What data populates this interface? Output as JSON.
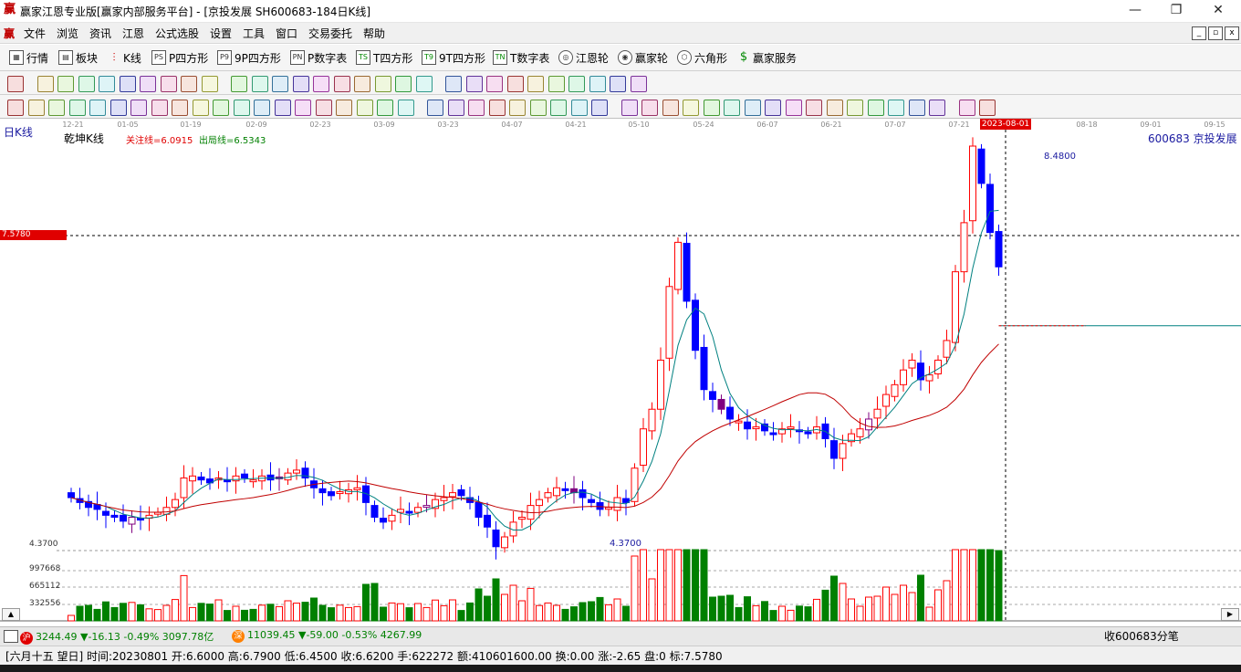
{
  "window": {
    "title": "赢家江恩专业版[赢家内部服务平台] - [京投发展  SH600683-184日K线]",
    "logo_char": "赢",
    "controls": {
      "minimize": "—",
      "restore": "❐",
      "close": "✕"
    }
  },
  "menubar": {
    "items": [
      "文件",
      "浏览",
      "资讯",
      "江恩",
      "公式选股",
      "设置",
      "工具",
      "窗口",
      "交易委托",
      "帮助"
    ],
    "mdi_controls": [
      "_",
      "▫",
      "x"
    ]
  },
  "toolbar1": {
    "buttons": [
      {
        "label": "行情",
        "icon": "grid-icon"
      },
      {
        "label": "板块",
        "icon": "blocks-icon"
      },
      {
        "label": "K线",
        "icon": "candle-icon"
      },
      {
        "label": "P四方形",
        "icon": "ps-icon",
        "icon_text": "PS"
      },
      {
        "label": "9P四方形",
        "icon": "p9-icon",
        "icon_text": "P9"
      },
      {
        "label": "P数字表",
        "icon": "pn-icon",
        "icon_text": "PN"
      },
      {
        "label": "T四方形",
        "icon": "ts-icon",
        "icon_text": "TS"
      },
      {
        "label": "9T四方形",
        "icon": "t9-icon",
        "icon_text": "T9"
      },
      {
        "label": "T数字表",
        "icon": "tn-icon",
        "icon_text": "TN"
      },
      {
        "label": "江恩轮",
        "icon": "wheel-icon"
      },
      {
        "label": "赢家轮",
        "icon": "wheel2-icon"
      },
      {
        "label": "六角形",
        "icon": "hexagon-icon"
      },
      {
        "label": "赢家服务",
        "icon": "dollar-icon"
      }
    ]
  },
  "chart": {
    "date_labels": [
      "12-21",
      "01-05",
      "01-19",
      "02-09",
      "02-23",
      "03-09",
      "03-23",
      "04-07",
      "04-21",
      "05-10",
      "05-24",
      "06-07",
      "06-21",
      "07-07",
      "07-21",
      "08-18",
      "09-01",
      "09-15"
    ],
    "cursor_date": "2023-08-01",
    "period_label": "日K线",
    "indicator_name": "乾坤K线",
    "focus_line": "关注线=6.0915",
    "exit_line": "出局线=6.5343",
    "stock_code": "600683",
    "stock_name": "京投发展",
    "price_flag": "7.5780",
    "high_label": "8.4800",
    "low_label": "4.3700",
    "low_axis_label": "4.3700",
    "volume_axis": [
      "997668",
      "665112",
      "332556"
    ],
    "colors": {
      "up": "#ff0000",
      "down": "#0000ff",
      "trans": "#800080",
      "ma_short": "#008080",
      "ma_long": "#c00000",
      "vol_up": "#ff0000",
      "vol_down": "#008000"
    }
  },
  "chart_data": {
    "type": "candlestick",
    "title": "京投发展 SH600683 日K线",
    "xlabel": "",
    "ylabel": "",
    "ylim": [
      4.37,
      8.48
    ],
    "x_ticks": [
      "12-21",
      "01-05",
      "01-19",
      "02-09",
      "02-23",
      "03-09",
      "03-23",
      "04-07",
      "04-21",
      "05-10",
      "05-24",
      "06-07",
      "06-21",
      "07-07",
      "07-21",
      "2023-08-01",
      "08-18",
      "09-01",
      "09-15"
    ],
    "series": [
      {
        "name": "乾坤K线",
        "close": [
          4.9,
          4.85,
          4.8,
          4.78,
          4.72,
          4.7,
          4.66,
          4.7,
          4.68,
          4.72,
          4.75,
          4.8,
          4.88,
          5.1,
          5.12,
          5.08,
          5.05,
          5.1,
          5.07,
          5.12,
          5.1,
          5.08,
          5.12,
          5.08,
          5.1,
          5.15,
          5.18,
          5.1,
          5.0,
          4.95,
          4.92,
          4.96,
          4.98,
          5.0,
          4.85,
          4.7,
          4.65,
          4.72,
          4.78,
          4.75,
          4.8,
          4.82,
          4.88,
          4.9,
          4.95,
          4.92,
          4.85,
          4.7,
          4.6,
          4.4,
          4.5,
          4.65,
          4.7,
          4.82,
          4.88,
          4.95,
          5.0,
          4.98,
          4.95,
          4.9,
          4.85,
          4.78,
          4.8,
          4.9,
          4.85,
          5.2,
          5.6,
          5.8,
          6.3,
          7.05,
          7.5,
          6.9,
          6.4,
          6.0,
          5.9,
          5.8,
          5.7,
          5.68,
          5.6,
          5.62,
          5.58,
          5.55,
          5.6,
          5.62,
          5.58,
          5.55,
          5.62,
          5.5,
          5.3,
          5.45,
          5.55,
          5.6,
          5.7,
          5.8,
          5.95,
          6.05,
          6.2,
          6.3,
          6.1,
          6.15,
          6.3,
          6.5,
          7.2,
          7.7,
          8.48,
          8.1,
          7.6,
          7.25
        ]
      },
      {
        "name": "短期均线",
        "values": []
      },
      {
        "name": "长期均线",
        "values": []
      }
    ],
    "annotations": [
      "关注线=6.0915",
      "出局线=6.5343",
      "8.4800",
      "4.3700",
      "7.5780"
    ],
    "volume_axis": [
      997668,
      665112,
      332556
    ]
  },
  "index_bar": {
    "sh": {
      "badge": "沪",
      "text": "3244.49 ▼-16.13 -0.49% 3097.78亿"
    },
    "sz": {
      "badge": "深",
      "text": "11039.45 ▼-59.00 -0.53% 4267.99"
    },
    "watch_button": "收600683分笔"
  },
  "statusbar": {
    "text": "[六月十五  望日] 时间:20230801 开:6.6000 高:6.7900 低:6.4500 收:6.6200 手:622272 额:410601600.00 换:0.00 涨:-2.65 盘:0 标:7.5780"
  }
}
